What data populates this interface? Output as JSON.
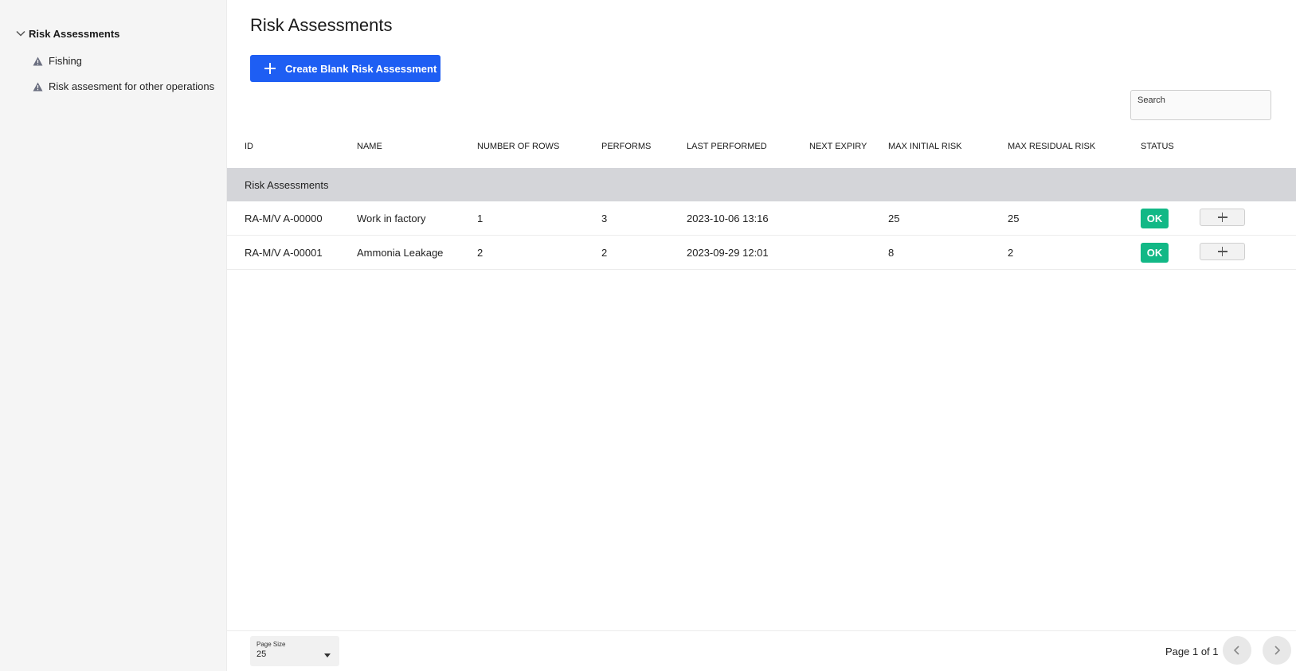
{
  "sidebar": {
    "root_label": "Risk Assessments",
    "items": [
      {
        "label": "Fishing"
      },
      {
        "label": "Risk assesment for other operations"
      }
    ]
  },
  "main": {
    "title": "Risk Assessments",
    "create_button_label": "Create Blank Risk Assessment",
    "search_placeholder": "Search"
  },
  "table": {
    "columns": [
      "ID",
      "NAME",
      "NUMBER OF ROWS",
      "PERFORMS",
      "LAST PERFORMED",
      "NEXT EXPIRY",
      "MAX INITIAL RISK",
      "MAX RESIDUAL RISK",
      "STATUS"
    ],
    "group_label": "Risk Assessments",
    "rows": [
      {
        "id": "RA-M/V A-00000",
        "name": "Work in factory",
        "rows": "1",
        "performs": "3",
        "last_performed": "2023-10-06 13:16",
        "next_expiry": "",
        "max_initial_risk": "25",
        "max_residual_risk": "25",
        "status": "OK"
      },
      {
        "id": "RA-M/V A-00001",
        "name": "Ammonia Leakage",
        "rows": "2",
        "performs": "2",
        "last_performed": "2023-09-29 12:01",
        "next_expiry": "",
        "max_initial_risk": "8",
        "max_residual_risk": "2",
        "status": "OK"
      }
    ]
  },
  "footer": {
    "page_size_label": "Page Size",
    "page_size_value": "25",
    "page_info": "Page 1 of 1"
  },
  "icons": {
    "tree_toggle": "chevron-down-icon",
    "item_icon": "warning-triangle-icon",
    "create": "plus-icon",
    "row_action": "plus-icon",
    "prev": "chevron-left-icon",
    "next": "chevron-right-icon",
    "dropdown": "caret-down-icon"
  },
  "colors": {
    "primary": "#1e5ef3",
    "status_ok": "#12b886",
    "group_bg": "#d4d5d9",
    "sidebar_bg": "#f5f5f5"
  }
}
